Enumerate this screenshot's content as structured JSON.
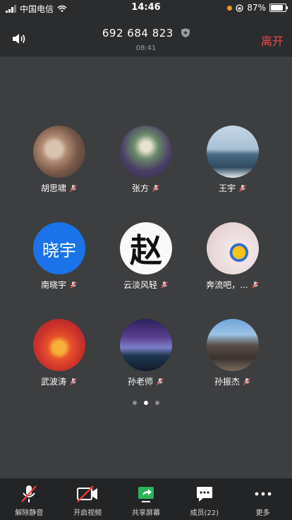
{
  "status_bar": {
    "carrier": "中国电信",
    "time": "14:46",
    "battery": "87%"
  },
  "header": {
    "meeting_id": "692 684 823",
    "duration": "08:41",
    "leave_label": "离开"
  },
  "participants": [
    {
      "name": "胡思啸"
    },
    {
      "name": "张方"
    },
    {
      "name": "王宇"
    },
    {
      "name": "南晓宇",
      "avatar_text": "晓宇"
    },
    {
      "name": "云淡风轻",
      "avatar_text": "赵"
    },
    {
      "name": "奔流吧，..."
    },
    {
      "name": "武波涛"
    },
    {
      "name": "孙老师"
    },
    {
      "name": "孙振杰"
    }
  ],
  "pager": {
    "pages": 3,
    "active": 2
  },
  "toolbar": {
    "unmute": "解除静音",
    "start_video": "开启视频",
    "share_screen": "共享屏幕",
    "members": "成员(22)",
    "more": "更多"
  },
  "colors": {
    "leave": "#f04848",
    "share_green": "#2bb35a",
    "avatar_blue": "#1a73e8"
  }
}
